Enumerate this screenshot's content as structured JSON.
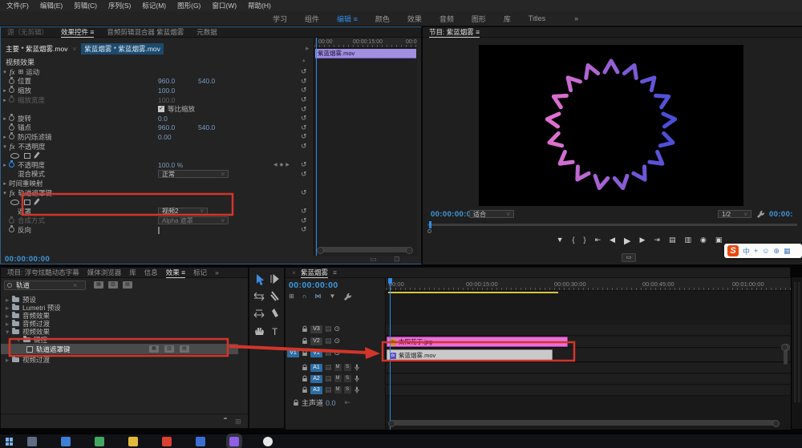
{
  "menu": {
    "items": [
      "文件(F)",
      "编辑(E)",
      "剪辑(C)",
      "序列(S)",
      "标记(M)",
      "图形(G)",
      "窗口(W)",
      "帮助(H)"
    ]
  },
  "workspace": {
    "tabs": [
      "学习",
      "组件",
      "编辑",
      "颜色",
      "效果",
      "音频",
      "图形",
      "库",
      "Titles"
    ],
    "overflow": "»"
  },
  "icons": {
    "menu": "≡",
    "overflow": "»",
    "caret_right": "▸",
    "caret_down": "▾",
    "caret_up": "▴",
    "chevron_down": "˅",
    "close": "×",
    "reset": "↺",
    "eye": "⊙",
    "fx": "fx",
    "motion": "⊞",
    "kf_prev": "◀",
    "kf_add": "◆",
    "kf_next": "▶",
    "check": "✓",
    "source_monitor": "▤",
    "fit_track": "⇤",
    "zoom_fit": "▭",
    "zoom_level": "⊡",
    "new_bin": "⊞",
    "play_small": "▸",
    "extra_button": "▭",
    "type_tool": "T"
  },
  "effect_controls": {
    "tabs": {
      "source": "源（无剪辑）",
      "controls": "效果控件",
      "mixer": "音频剪辑混合器 紫蓝烟雾",
      "metadata": "元数据"
    },
    "master_clip": "主要 * 紫蓝烟雾.mov",
    "sequence_clip": "紫蓝烟雾 * 紫蓝烟雾.mov",
    "section_video": "视频效果",
    "motion": {
      "label": "运动",
      "position_label": "位置",
      "position_x": "960.0",
      "position_y": "540.0",
      "scale_label": "缩放",
      "scale": "100.0",
      "scale_width_label": "缩放宽度",
      "scale_width": "100.0",
      "uniform_label": "等比缩放",
      "rotation_label": "旋转",
      "rotation": "0.0",
      "anchor_label": "锚点",
      "anchor_x": "960.0",
      "anchor_y": "540.0",
      "flicker_label": "防闪烁滤镜",
      "flicker": "0.00"
    },
    "opacity": {
      "label": "不透明度",
      "value": "100.0 %",
      "blend_label": "混合模式",
      "blend": "正常"
    },
    "time_remap": {
      "label": "时间重映射"
    },
    "track_matte": {
      "label": "轨道遮罩键",
      "matte_label": "遮罩",
      "matte": "视频2",
      "composite_label": "合成方式",
      "composite": "Alpha 遮罩",
      "reverse_label": "反向"
    },
    "mini_ruler": [
      "00:00",
      "00:00:15:00",
      "00:0"
    ],
    "mini_clip": "紫蓝烟雾.mov",
    "timecode": "00:00:00:00"
  },
  "program": {
    "tab": "节目: 紫蓝烟雾",
    "timecode": "00:00:00:00",
    "fit": "适合",
    "zoom": "1/2",
    "duration": "00:00:",
    "transport": [
      {
        "name": "add-marker-button",
        "glyph": "▼"
      },
      {
        "name": "mark-in-button",
        "glyph": "{"
      },
      {
        "name": "mark-out-button",
        "glyph": "}"
      },
      {
        "name": "go-to-in-button",
        "glyph": "⇤"
      },
      {
        "name": "step-back-button",
        "glyph": "◀"
      },
      {
        "name": "play-button",
        "glyph": "▶"
      },
      {
        "name": "step-forward-button",
        "glyph": "▶"
      },
      {
        "name": "go-to-out-button",
        "glyph": "⇥"
      },
      {
        "name": "lift-button",
        "glyph": "▤"
      },
      {
        "name": "extract-button",
        "glyph": "▥"
      },
      {
        "name": "export-frame-button",
        "glyph": "◉"
      },
      {
        "name": "compare-view-button",
        "glyph": "▣"
      }
    ]
  },
  "project": {
    "tabs": [
      "项目: 浮夸炫酷动态字幕",
      "媒体浏览器",
      "库",
      "信息",
      "效果",
      "标记"
    ],
    "overflow": "»",
    "search_value": "轨道",
    "filter_badges": [
      "▦",
      "▥",
      "▤"
    ],
    "tree": [
      {
        "label": "预设",
        "caret": "▸"
      },
      {
        "label": "Lumetri 预设",
        "caret": "▸"
      },
      {
        "label": "音频效果",
        "caret": "▸"
      },
      {
        "label": "音频过渡",
        "caret": "▸"
      },
      {
        "label": "视频效果",
        "caret": "▾"
      },
      {
        "label": "键控",
        "caret": "▾"
      },
      {
        "label": "轨道遮罩键",
        "caret": ""
      },
      {
        "label": "视频过渡",
        "caret": "▸"
      }
    ],
    "row_badges": [
      "▦",
      "▥",
      "▤"
    ]
  },
  "timeline": {
    "tab": "紫蓝烟雾",
    "timecode": "00:00:00:00",
    "toolbar": [
      {
        "name": "nest-insert-icon",
        "glyph": "⊞"
      },
      {
        "name": "snap-icon",
        "glyph": "∩"
      },
      {
        "name": "linked-selection-icon",
        "glyph": "⋈"
      },
      {
        "name": "add-marker-icon",
        "glyph": "▼"
      }
    ],
    "ruler": [
      "00:00",
      "00:00:15:00",
      "00:00:30:00",
      "00:00:45:00",
      "00:01:00:00"
    ],
    "video_tracks": [
      "V3",
      "V2",
      "V1"
    ],
    "audio_tracks": [
      "A1",
      "A2",
      "A3"
    ],
    "master_label": "主声道",
    "master_value": "0.0",
    "mute_label": "M",
    "solo_label": "S",
    "clip_v2": "太阳花丁.jpg",
    "clip_v1": "紫蓝烟雾.mov"
  },
  "sogou": {
    "logo": "S",
    "icons": [
      "中",
      "+",
      "☺",
      "⊕",
      "▦"
    ]
  },
  "taskbar": {
    "icons": [
      {
        "name": "taskbar-icon-1",
        "color": "#5f6e84"
      },
      {
        "name": "taskbar-icon-2",
        "color": "#3f7fd6"
      },
      {
        "name": "taskbar-icon-3",
        "color": "#41a85f"
      },
      {
        "name": "taskbar-icon-4",
        "color": "#e3b93c"
      },
      {
        "name": "taskbar-icon-5",
        "color": "#d8402f"
      },
      {
        "name": "taskbar-icon-6",
        "color": "#3b6fd4"
      },
      {
        "name": "taskbar-icon-premiere",
        "color": "#8f5fe8"
      },
      {
        "name": "taskbar-icon-8",
        "color": "#e8e8e8"
      }
    ]
  },
  "video_ring": {
    "count": 17,
    "color_pink": "#e070cf",
    "color_blue": "#4b4fd8"
  },
  "colors": {
    "accent": "#2d8ceb",
    "timecode_blue": "#3f9ae0",
    "value_blue": "#7c9cc4",
    "annotation": "#d3352b",
    "clip_pink": "#ea6fd9",
    "clip_gray": "#c9c9c9",
    "clip_purple": "#a18fe0",
    "workarea_yellow": "#d8c53e",
    "sogou_orange": "#e8490f"
  }
}
